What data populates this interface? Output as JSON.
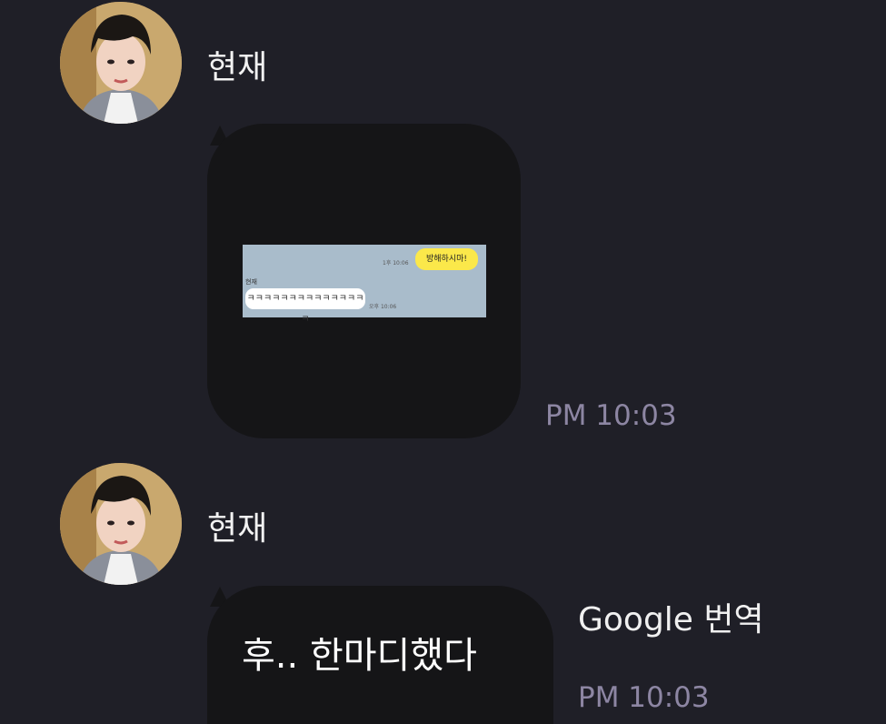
{
  "messages": [
    {
      "sender": "현재",
      "type": "image",
      "image": {
        "sent_bubble": "방해하시마!",
        "sent_meta": "1후 10:06",
        "reply_sender": "현재",
        "reply_bubble": "ㅋㅋㅋㅋㅋㅋㅋㅋㅋㅋㅋㅋㅋㅋㅋ",
        "reply_meta": "오후 10:06"
      },
      "time": "PM 10:03"
    },
    {
      "sender": "현재",
      "type": "text",
      "text": "후.. 한마디했다",
      "translate_label": "Google 번역",
      "time": "PM 10:03"
    }
  ],
  "colors": {
    "background": "#1f1f27",
    "bubble": "#151517",
    "timestamp": "#8d86a3",
    "kakao_yellow": "#fbe84a",
    "kakao_bg": "#a9bccb"
  },
  "icons": [
    "avatar-photo"
  ]
}
